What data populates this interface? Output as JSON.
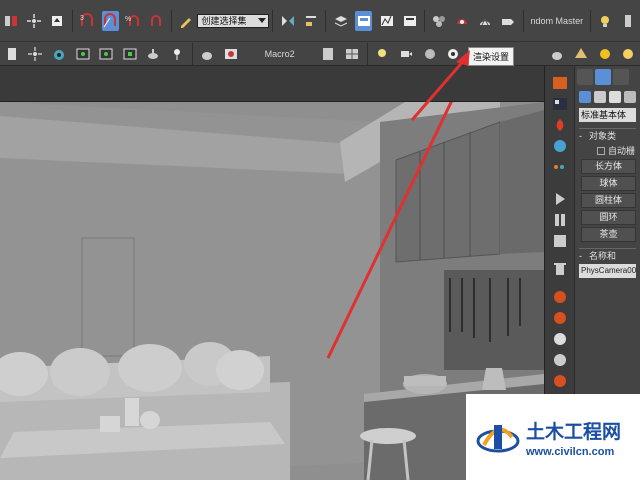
{
  "toolbar_main": {
    "selection_set": "创建选择集",
    "plugin_label": "ndom Master",
    "icons": [
      "bind-icon",
      "select-region-icon",
      "select-move-icon",
      "select-rotate-icon",
      "snap-icon",
      "angle-snap-icon",
      "mirror-icon",
      "align-icon",
      "layer-icon",
      "graph-editor-icon",
      "material-editor-icon",
      "render-setup-icon",
      "render-frame-icon",
      "render-icon",
      "light-icon"
    ]
  },
  "toolbar_second": {
    "macro_label": "Macro2",
    "tooltip": "渲染设置"
  },
  "command_panel": {
    "category": "标准基本体",
    "object_type_title": "对象类",
    "autogrid_label": "自动栅",
    "objects": [
      "长方体",
      "球体",
      "圆柱体",
      "圆环",
      "茶壶"
    ],
    "name_color_title": "名称和",
    "name_value": "PhysCamera00"
  },
  "watermark": {
    "title": "土木工程网",
    "url": "www.civilcn.com"
  },
  "colors": {
    "active_accent": "#5b8fd6",
    "annotation_arrow": "#e03030",
    "watermark_blue": "#1a4fa3"
  }
}
